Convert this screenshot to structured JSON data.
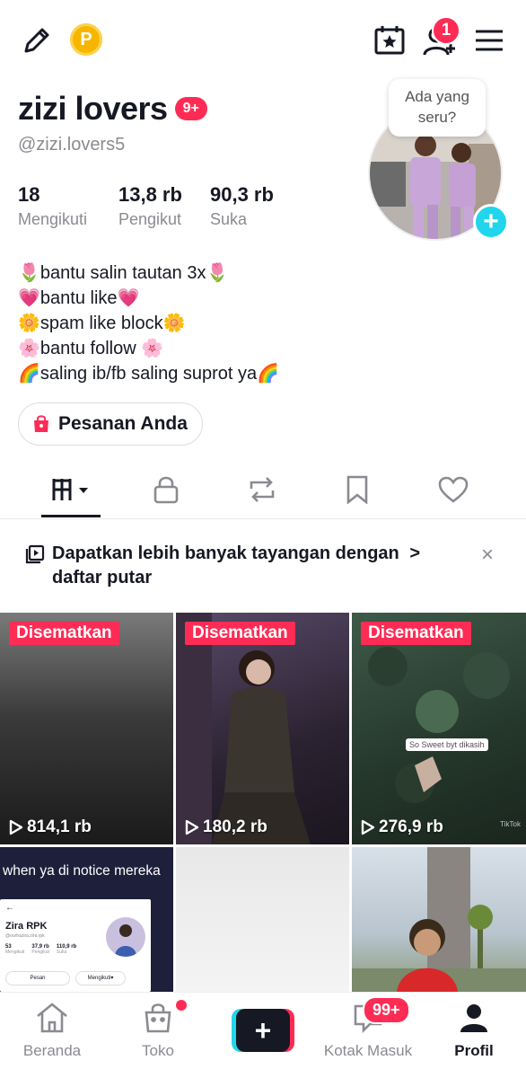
{
  "topbar": {
    "notification_count": "1"
  },
  "profile": {
    "name": "zizi lovers",
    "name_badge": "9+",
    "handle": "@zizi.lovers5",
    "stats": [
      {
        "value": "18",
        "label": "Mengikuti"
      },
      {
        "value": "13,8 rb",
        "label": "Pengikut"
      },
      {
        "value": "90,3 rb",
        "label": "Suka"
      }
    ],
    "avatar_bubble": [
      "Ada yang",
      "seru?"
    ],
    "bio": [
      "🌷bantu salin tautan 3x🌷",
      "💗bantu like💗",
      "🌼spam like block🌼",
      "🌸bantu follow 🌸",
      "🌈saling ib/fb saling suprot ya🌈"
    ],
    "orders_label": "Pesanan Anda"
  },
  "promo": {
    "text": "Dapatkan lebih banyak tayangan dengan  daftar putar",
    "line1": "Dapatkan lebih banyak tayangan dengan",
    "line2": "daftar putar",
    "arrow": ">",
    "close": "×"
  },
  "videos": [
    {
      "pinned": "Disematkan",
      "views": "814,1 rb"
    },
    {
      "pinned": "Disematkan",
      "views": "180,2 rb"
    },
    {
      "pinned": "Disematkan",
      "views": "276,9 rb"
    }
  ],
  "video4": {
    "caption": "when ya di notice mereka",
    "inner_name": "Zira RPK",
    "inner_handle": "@ourhazira.zira.rpk",
    "inner_stats": [
      {
        "value": "53",
        "label": "Mengikuti"
      },
      {
        "value": "37,9 rb",
        "label": "Pengikut"
      },
      {
        "value": "110,9 rb",
        "label": "Suka"
      }
    ],
    "inner_btn1": "Pesan",
    "inner_btn2": "Mengikuti▾"
  },
  "video3_overlay": {
    "sticker": "So Sweet byt dikasih",
    "watermark": "TikTok"
  },
  "bottomnav": {
    "home": "Beranda",
    "shop": "Toko",
    "inbox": "Kotak Masuk",
    "inbox_badge": "99+",
    "profile": "Profil"
  }
}
